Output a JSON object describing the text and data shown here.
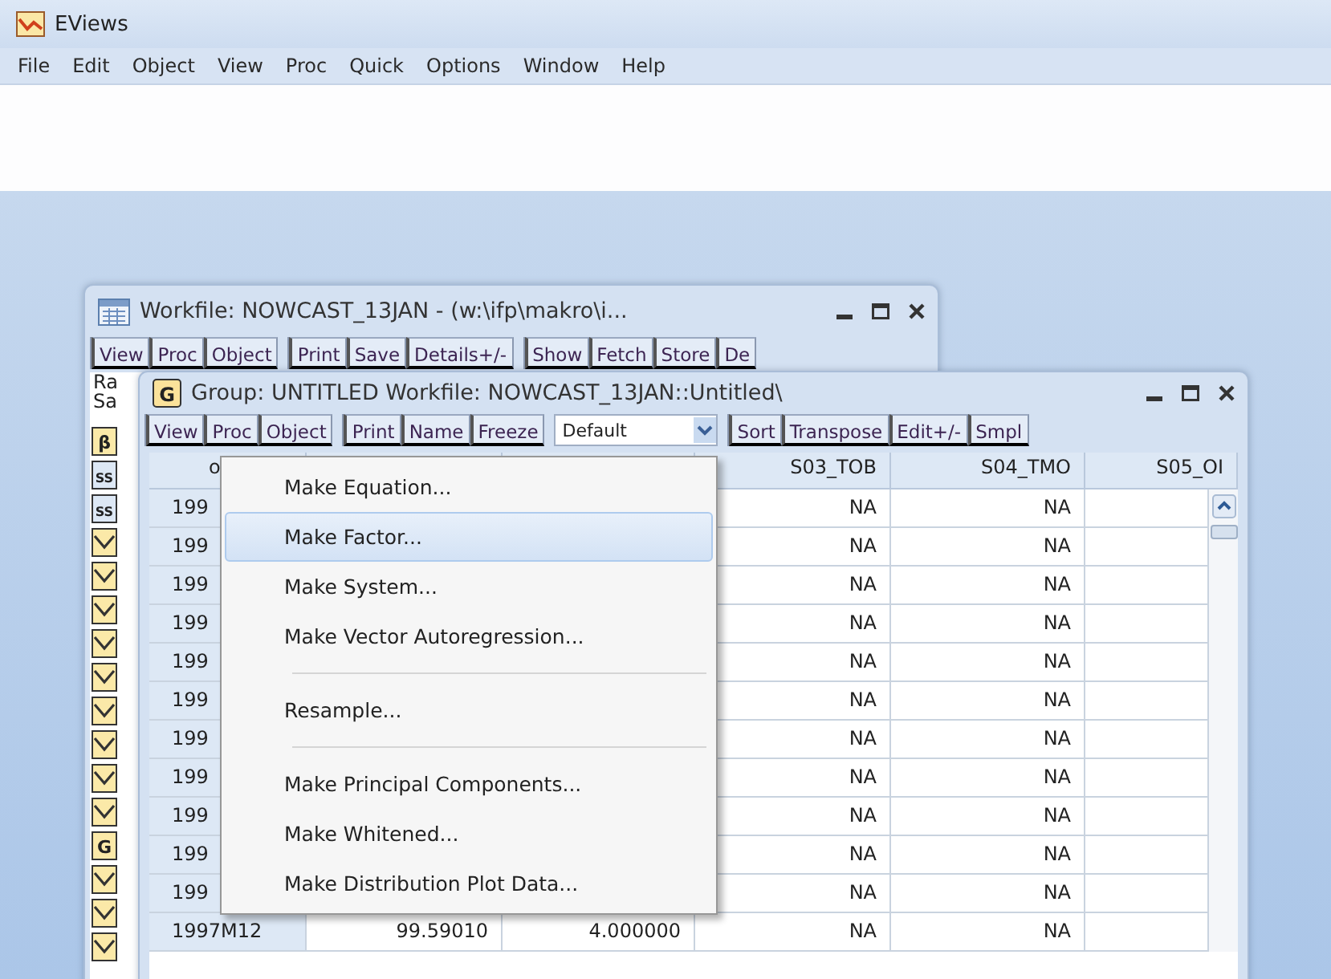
{
  "app": {
    "title": "EViews"
  },
  "menubar": [
    {
      "label": "File"
    },
    {
      "label": "Edit"
    },
    {
      "label": "Object"
    },
    {
      "label": "View"
    },
    {
      "label": "Proc"
    },
    {
      "label": "Quick"
    },
    {
      "label": "Options"
    },
    {
      "label": "Window"
    },
    {
      "label": "Help"
    }
  ],
  "workfile_window": {
    "title": "Workfile: NOWCAST_13JAN - (w:\\ifp\\makro\\i...",
    "toolbar": [
      [
        "View",
        "Proc",
        "Object"
      ],
      [
        "Print",
        "Save",
        "Details+/-"
      ],
      [
        "Show",
        "Fetch",
        "Store",
        "De"
      ]
    ],
    "labels": [
      "Ra",
      "Sa"
    ],
    "objects": [
      {
        "kind": "coef",
        "label": "β"
      },
      {
        "kind": "scalar",
        "label": "SS"
      },
      {
        "kind": "scalar",
        "label": "SS"
      },
      {
        "kind": "series"
      },
      {
        "kind": "series"
      },
      {
        "kind": "series"
      },
      {
        "kind": "series"
      },
      {
        "kind": "series"
      },
      {
        "kind": "series"
      },
      {
        "kind": "series"
      },
      {
        "kind": "series"
      },
      {
        "kind": "series"
      },
      {
        "kind": "group",
        "label": "G"
      },
      {
        "kind": "series"
      },
      {
        "kind": "series"
      },
      {
        "kind": "series"
      }
    ]
  },
  "group_window": {
    "icon_label": "G",
    "title": "Group: UNTITLED   Workfile: NOWCAST_13JAN::Untitled\\",
    "toolbar": [
      [
        "View",
        "Proc",
        "Object"
      ],
      [
        "Print",
        "Name",
        "Freeze"
      ]
    ],
    "dropdown": {
      "value": "Default"
    },
    "toolbar_right": [
      "Sort",
      "Transpose",
      "Edit+/-",
      "Smpl"
    ],
    "table": {
      "columns": [
        "o",
        "",
        "",
        "S03_TOB",
        "S04_TMO",
        "S05_OI"
      ],
      "rows": [
        {
          "obs": "199",
          "s03_tob": "NA",
          "s04_tmo": "NA"
        },
        {
          "obs": "199",
          "s03_tob": "NA",
          "s04_tmo": "NA"
        },
        {
          "obs": "199",
          "s03_tob": "NA",
          "s04_tmo": "NA"
        },
        {
          "obs": "199",
          "s03_tob": "NA",
          "s04_tmo": "NA"
        },
        {
          "obs": "199",
          "s03_tob": "NA",
          "s04_tmo": "NA"
        },
        {
          "obs": "199",
          "s03_tob": "NA",
          "s04_tmo": "NA"
        },
        {
          "obs": "199",
          "s03_tob": "NA",
          "s04_tmo": "NA"
        },
        {
          "obs": "199",
          "s03_tob": "NA",
          "s04_tmo": "NA"
        },
        {
          "obs": "199",
          "s03_tob": "NA",
          "s04_tmo": "NA"
        },
        {
          "obs": "199",
          "s03_tob": "NA",
          "s04_tmo": "NA"
        },
        {
          "obs": "199",
          "s03_tob": "NA",
          "s04_tmo": "NA"
        },
        {
          "obs": "1997M12",
          "column_2": "99.59010",
          "column_3": "4.000000",
          "s03_tob": "NA",
          "s04_tmo": "NA"
        }
      ]
    }
  },
  "proc_menu": [
    {
      "kind": "item",
      "label": "Make Equation...",
      "selected": false
    },
    {
      "kind": "item",
      "label": "Make Factor...",
      "selected": true
    },
    {
      "kind": "item",
      "label": "Make System...",
      "selected": false
    },
    {
      "kind": "item",
      "label": "Make Vector Autoregression...",
      "selected": false
    },
    {
      "kind": "separator"
    },
    {
      "kind": "item",
      "label": "Resample...",
      "selected": false
    },
    {
      "kind": "separator"
    },
    {
      "kind": "item",
      "label": "Make Principal Components...",
      "selected": false
    },
    {
      "kind": "item",
      "label": "Make Whitened...",
      "selected": false
    },
    {
      "kind": "item",
      "label": "Make Distribution Plot Data...",
      "selected": false
    }
  ]
}
